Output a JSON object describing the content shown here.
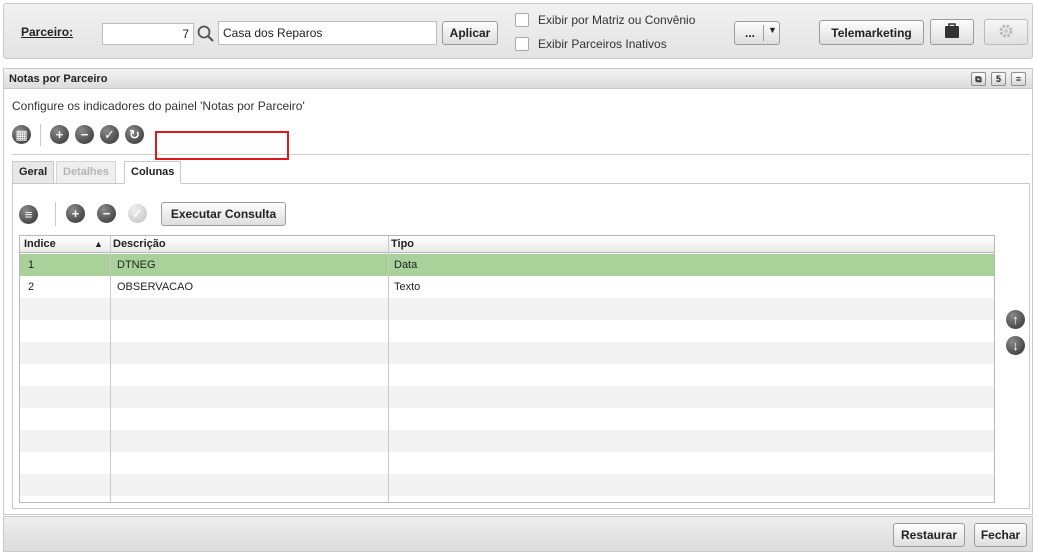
{
  "toolbar": {
    "parceiro_label": "Parceiro:",
    "parceiro_code": "7",
    "parceiro_name": "Casa dos Reparos",
    "aplicar_label": "Aplicar",
    "matriz_label": "Exibir por Matriz ou Convênio",
    "inativos_label": "Exibir Parceiros Inativos",
    "more_label": "...",
    "telemarketing_label": "Telemarketing"
  },
  "panel": {
    "title": "Notas por Parceiro",
    "subtitle": "Configure os indicadores do painel 'Notas por Parceiro'",
    "header_buttons": [
      "⧉",
      "5",
      "≡"
    ]
  },
  "tabs": [
    {
      "label": "Geral",
      "state": "normal"
    },
    {
      "label": "Detalhes",
      "state": "disabled"
    },
    {
      "label": "Colunas",
      "state": "active"
    }
  ],
  "columns_tab": {
    "execute_label": "Executar Consulta"
  },
  "grid": {
    "headers": [
      "Indice",
      "▲",
      "Descrição",
      "Tipo"
    ],
    "rows": [
      {
        "indice": "1",
        "descricao": "DTNEG",
        "tipo": "Data"
      },
      {
        "indice": "2",
        "descricao": "OBSERVACAO",
        "tipo": "Texto"
      }
    ]
  },
  "footer": {
    "restaurar_label": "Restaurar",
    "fechar_label": "Fechar"
  },
  "colors": {
    "selected_row": "#a8d29a",
    "highlight_border": "#e0191f"
  }
}
